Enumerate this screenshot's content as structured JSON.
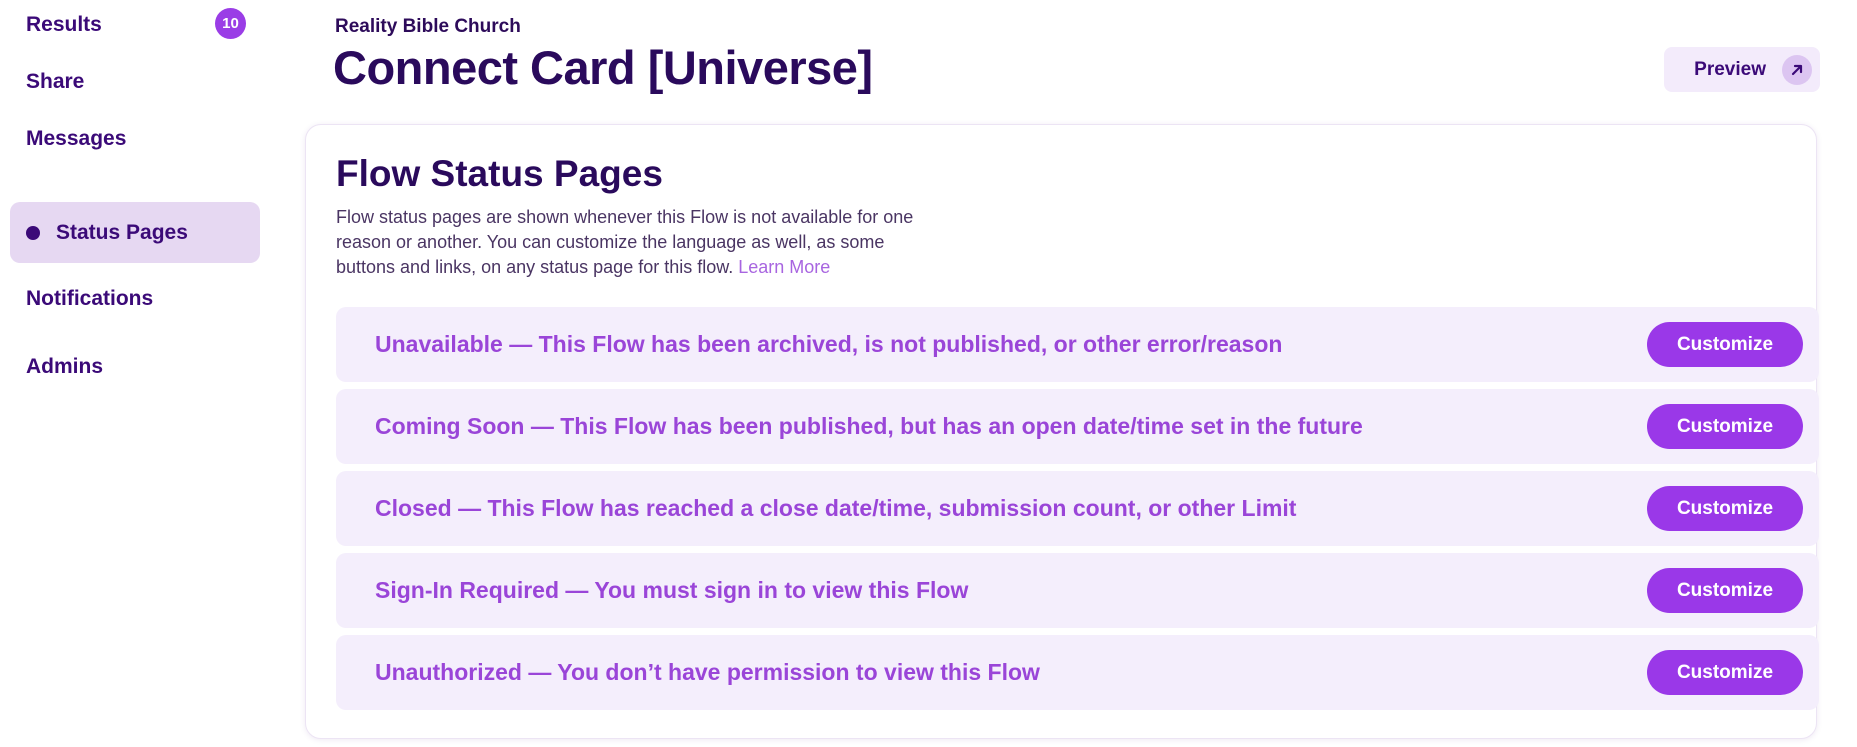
{
  "sidebar": {
    "items": [
      {
        "label": "Results",
        "badge": "10"
      },
      {
        "label": "Share"
      },
      {
        "label": "Messages"
      },
      {
        "label": "Status Pages",
        "active": true
      },
      {
        "label": "Notifications"
      },
      {
        "label": "Admins"
      }
    ]
  },
  "header": {
    "org_name": "Reality Bible Church",
    "title": "Connect Card [Universe]",
    "preview_label": "Preview",
    "preview_icon": "arrow-up-right-icon"
  },
  "card": {
    "title": "Flow Status Pages",
    "description": "Flow status pages are shown whenever this Flow is not available for one reason or another. You can customize the language as well, as some buttons and links, on any status page for this flow.",
    "learn_more": "Learn More"
  },
  "statuses": [
    {
      "text": "Unavailable — This Flow has been archived, is not published, or other error/reason",
      "button": "Customize"
    },
    {
      "text": "Coming Soon — This Flow has been published, but has an open date/time set in the future",
      "button": "Customize"
    },
    {
      "text": "Closed — This Flow has reached a close date/time, submission count, or other Limit",
      "button": "Customize"
    },
    {
      "text": "Sign-In Required — You must sign in to view this Flow",
      "button": "Customize"
    },
    {
      "text": "Unauthorized — You don’t have permission to view this Flow",
      "button": "Customize"
    }
  ],
  "colors": {
    "accent": "#9a38e8",
    "nav_text": "#3b0a78",
    "title_text": "#2a0a5c",
    "status_text": "#9a45d8",
    "row_background": "#f4eefc",
    "active_nav_background": "#e6d8f2"
  }
}
